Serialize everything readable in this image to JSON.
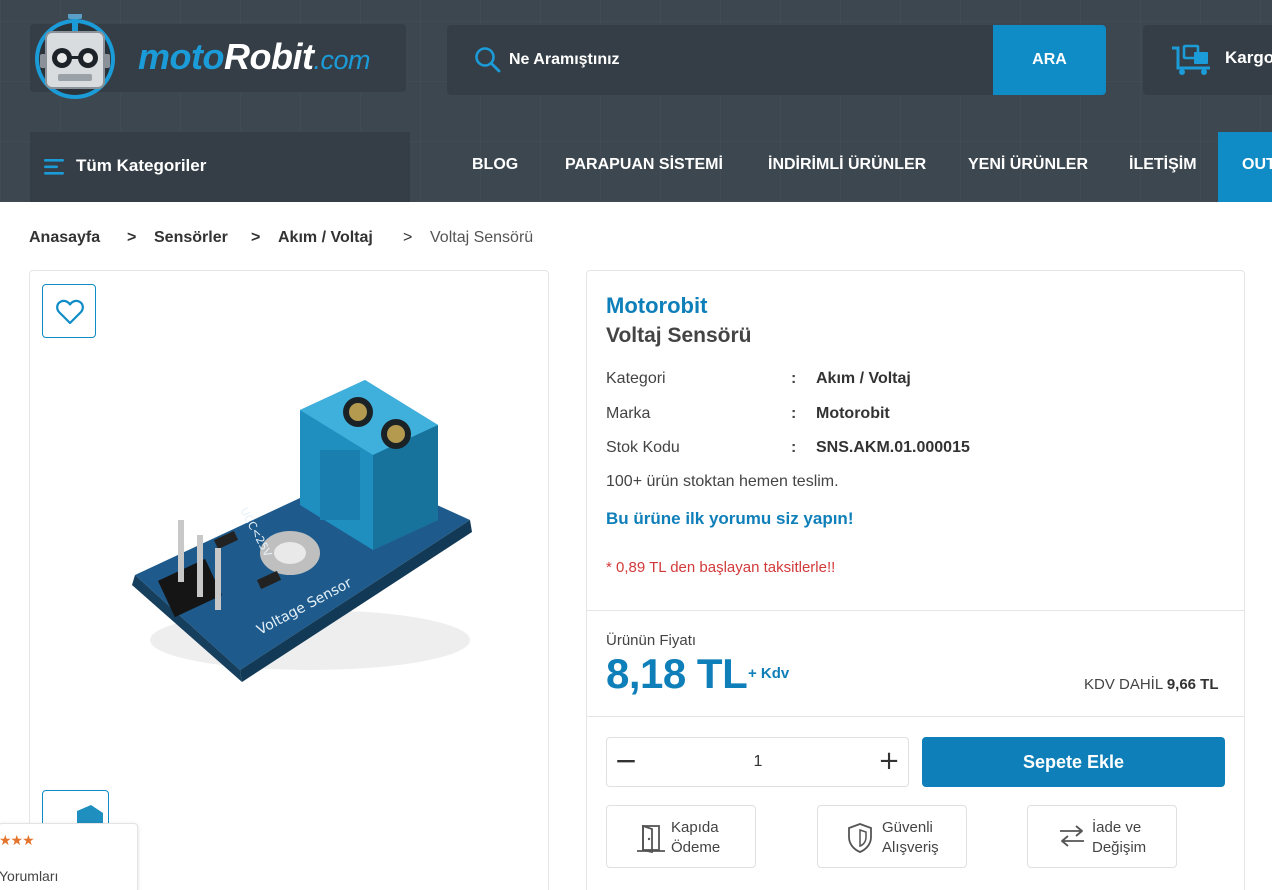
{
  "header": {
    "logo": {
      "part1": "moto",
      "part2": "Robit",
      "part3": ".com"
    },
    "search": {
      "placeholder": "Ne Aramıştınız",
      "button_label": "ARA"
    },
    "cargo_label": "Kargo"
  },
  "nav": {
    "all_categories": "Tüm Kategoriler",
    "items": [
      "BLOG",
      "PARAPUAN SİSTEMİ",
      "İNDİRİMLİ ÜRÜNLER",
      "YENİ ÜRÜNLER",
      "İLETİŞİM",
      "OUTLET"
    ]
  },
  "breadcrumb": {
    "items": [
      "Anasayfa",
      "Sensörler",
      "Akım / Voltaj",
      "Voltaj Sensörü"
    ],
    "separator": ">"
  },
  "product": {
    "brand": "Motorobit",
    "name": "Voltaj Sensörü",
    "specs": [
      {
        "key": "Kategori",
        "value": "Akım / Voltaj"
      },
      {
        "key": "Marka",
        "value": "Motorobit"
      },
      {
        "key": "Stok Kodu",
        "value": "SNS.AKM.01.000015"
      }
    ],
    "colon": ":",
    "stock_text": "100+ ürün stoktan hemen teslim.",
    "review_link": "Bu ürüne ilk yorumu siz yapın!",
    "installment_text": "* 0,89 TL den başlayan taksitlerle!!",
    "price_label": "Ürünün Fiyatı",
    "price": "8,18 TL",
    "kdv_plus": "+ Kdv",
    "kdv_included_label": "KDV DAHİL",
    "kdv_included_price": "9,66 TL",
    "quantity": "1",
    "minus_label": "−",
    "plus_label": "+",
    "add_to_cart": "Sepete Ekle",
    "pcb_text_top": "UCC<25V",
    "pcb_text_bottom": "Voltage Sensor"
  },
  "features": [
    {
      "line1": "Kapıda",
      "line2": "Ödeme",
      "icon": "door-icon"
    },
    {
      "line1": "Güvenli",
      "line2": "Alışveriş",
      "icon": "shield-icon"
    },
    {
      "line1": "İade ve",
      "line2": "Değişim",
      "icon": "exchange-icon"
    }
  ],
  "review_widget": {
    "stars": "★★★",
    "label": "Yorumları"
  },
  "colors": {
    "accent": "#0f8bc6",
    "header_bg": "#3d474f",
    "price": "#0f7fb9",
    "installment": "#d23a3a"
  }
}
